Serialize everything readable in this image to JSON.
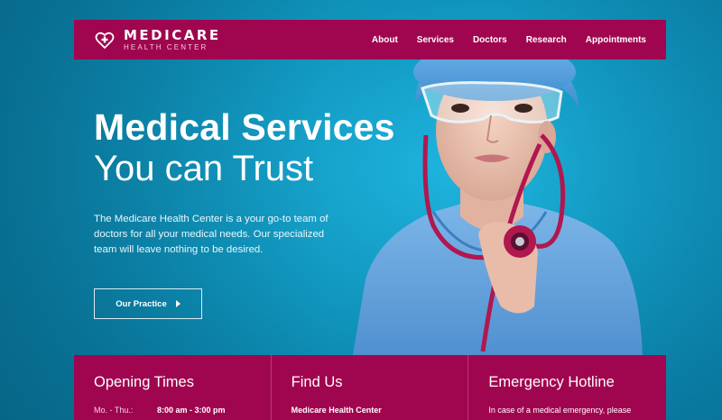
{
  "nav": {
    "logo_name": "MEDICARE",
    "logo_sub": "HEALTH CENTER",
    "links": [
      "About",
      "Services",
      "Doctors",
      "Research",
      "Appointments"
    ]
  },
  "hero": {
    "title_line1": "Medical Services",
    "title_line2": "You can Trust",
    "description": "The Medicare Health Center is a your go-to team of doctors for all your medical needs. Our specialized team will leave nothing to be desired.",
    "cta_label": "Our Practice"
  },
  "info": {
    "opening": {
      "title": "Opening Times",
      "day": "Mo. - Thu.:",
      "hours": "8:00 am - 3:00 pm"
    },
    "find": {
      "title": "Find Us",
      "name": "Medicare Health Center"
    },
    "emergency": {
      "title": "Emergency Hotline",
      "text": "In case of a medical emergency, please"
    }
  },
  "colors": {
    "brand": "#a0064f",
    "background": "#139cc4",
    "scrubs": "#5ea3dc",
    "stethoscope": "#b0184f"
  },
  "icons": [
    "heart-cross-icon",
    "arrow-right-icon"
  ]
}
